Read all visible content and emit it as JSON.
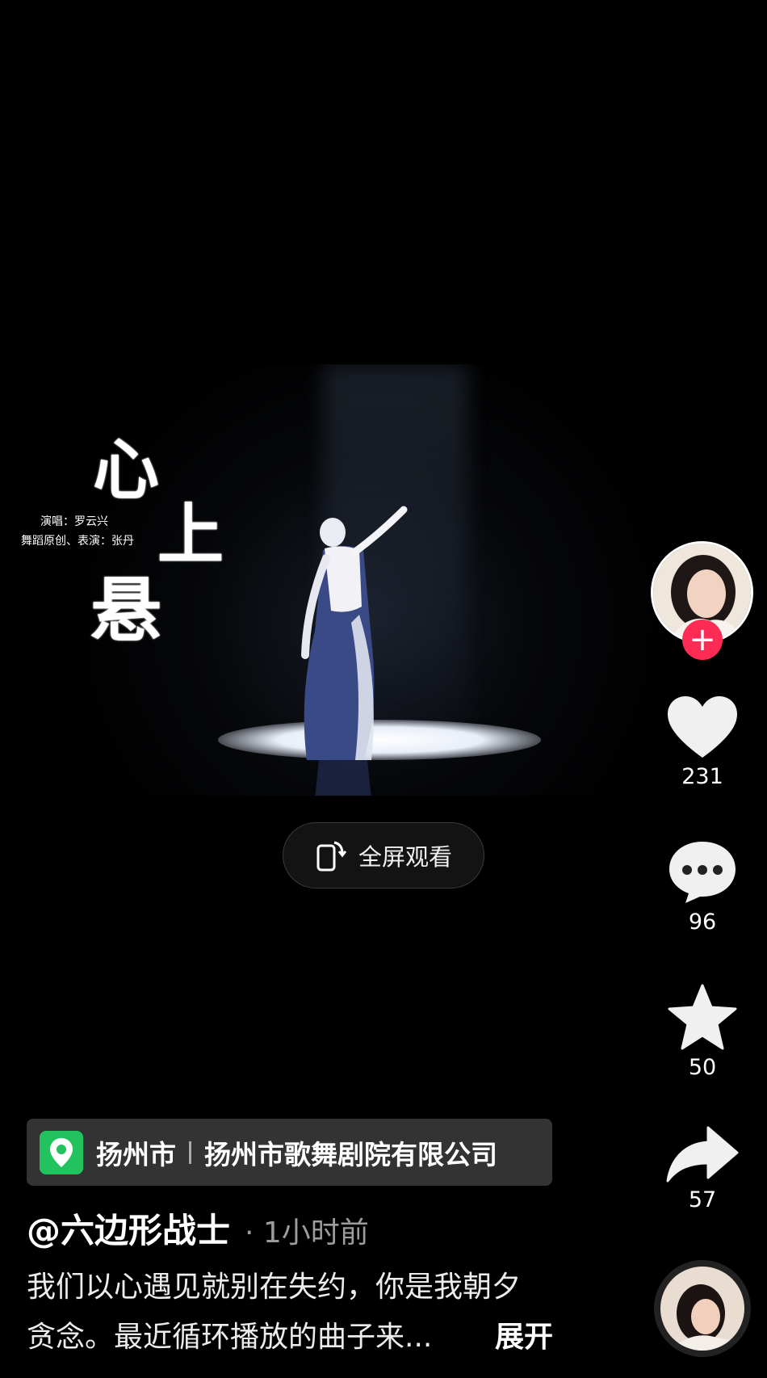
{
  "video": {
    "title_chars": [
      "心",
      "上",
      "悬"
    ],
    "credit_singer": "演唱：罗云兴",
    "credit_dance": "舞蹈原创、表演：张丹"
  },
  "fullscreen": {
    "label": "全屏观看",
    "icon": "rotate-phone-icon"
  },
  "sidebar": {
    "follow_label": "+",
    "likes": "231",
    "comments": "96",
    "favorites": "50",
    "shares": "57"
  },
  "location": {
    "city": "扬州市",
    "place": "扬州市歌舞剧院有限公司",
    "icon": "location-pin-icon",
    "icon_color": "#22c35e"
  },
  "post": {
    "author": "@六边形战士",
    "time": "· 1小时前",
    "caption_line1": "我们以心遇见就别在失约，你是我朝夕",
    "caption_line2": "贪念。最近循环播放的曲子来...",
    "expand_label": "展开"
  },
  "colors": {
    "accent": "#fe2c55",
    "background": "#000000"
  }
}
